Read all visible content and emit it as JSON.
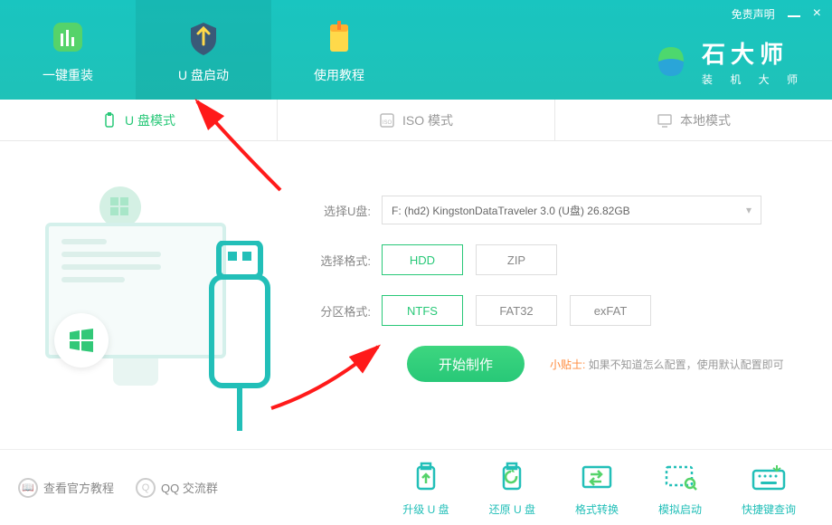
{
  "titlebar": {
    "disclaimer": "免责声明"
  },
  "nav": {
    "items": [
      {
        "label": "一键重装"
      },
      {
        "label": "U 盘启动"
      },
      {
        "label": "使用教程"
      }
    ]
  },
  "brand": {
    "title": "石大师",
    "sub": "装 机 大 师"
  },
  "tabs": [
    {
      "label": "U 盘模式"
    },
    {
      "label": "ISO 模式"
    },
    {
      "label": "本地模式"
    }
  ],
  "form": {
    "udisk_label": "选择U盘:",
    "udisk_value": "F: (hd2) KingstonDataTraveler 3.0 (U盘) 26.82GB",
    "format_label": "选择格式:",
    "format_opts": [
      "HDD",
      "ZIP"
    ],
    "partition_label": "分区格式:",
    "partition_opts": [
      "NTFS",
      "FAT32",
      "exFAT"
    ],
    "primary": "开始制作",
    "tip_label": "小贴士:",
    "tip_text": " 如果不知道怎么配置，使用默认配置即可"
  },
  "bottom": {
    "links": [
      {
        "label": "查看官方教程"
      },
      {
        "label": "QQ 交流群"
      }
    ],
    "tools": [
      {
        "label": "升级 U 盘"
      },
      {
        "label": "还原 U 盘"
      },
      {
        "label": "格式转换"
      },
      {
        "label": "模拟启动"
      },
      {
        "label": "快捷键查询"
      }
    ]
  }
}
